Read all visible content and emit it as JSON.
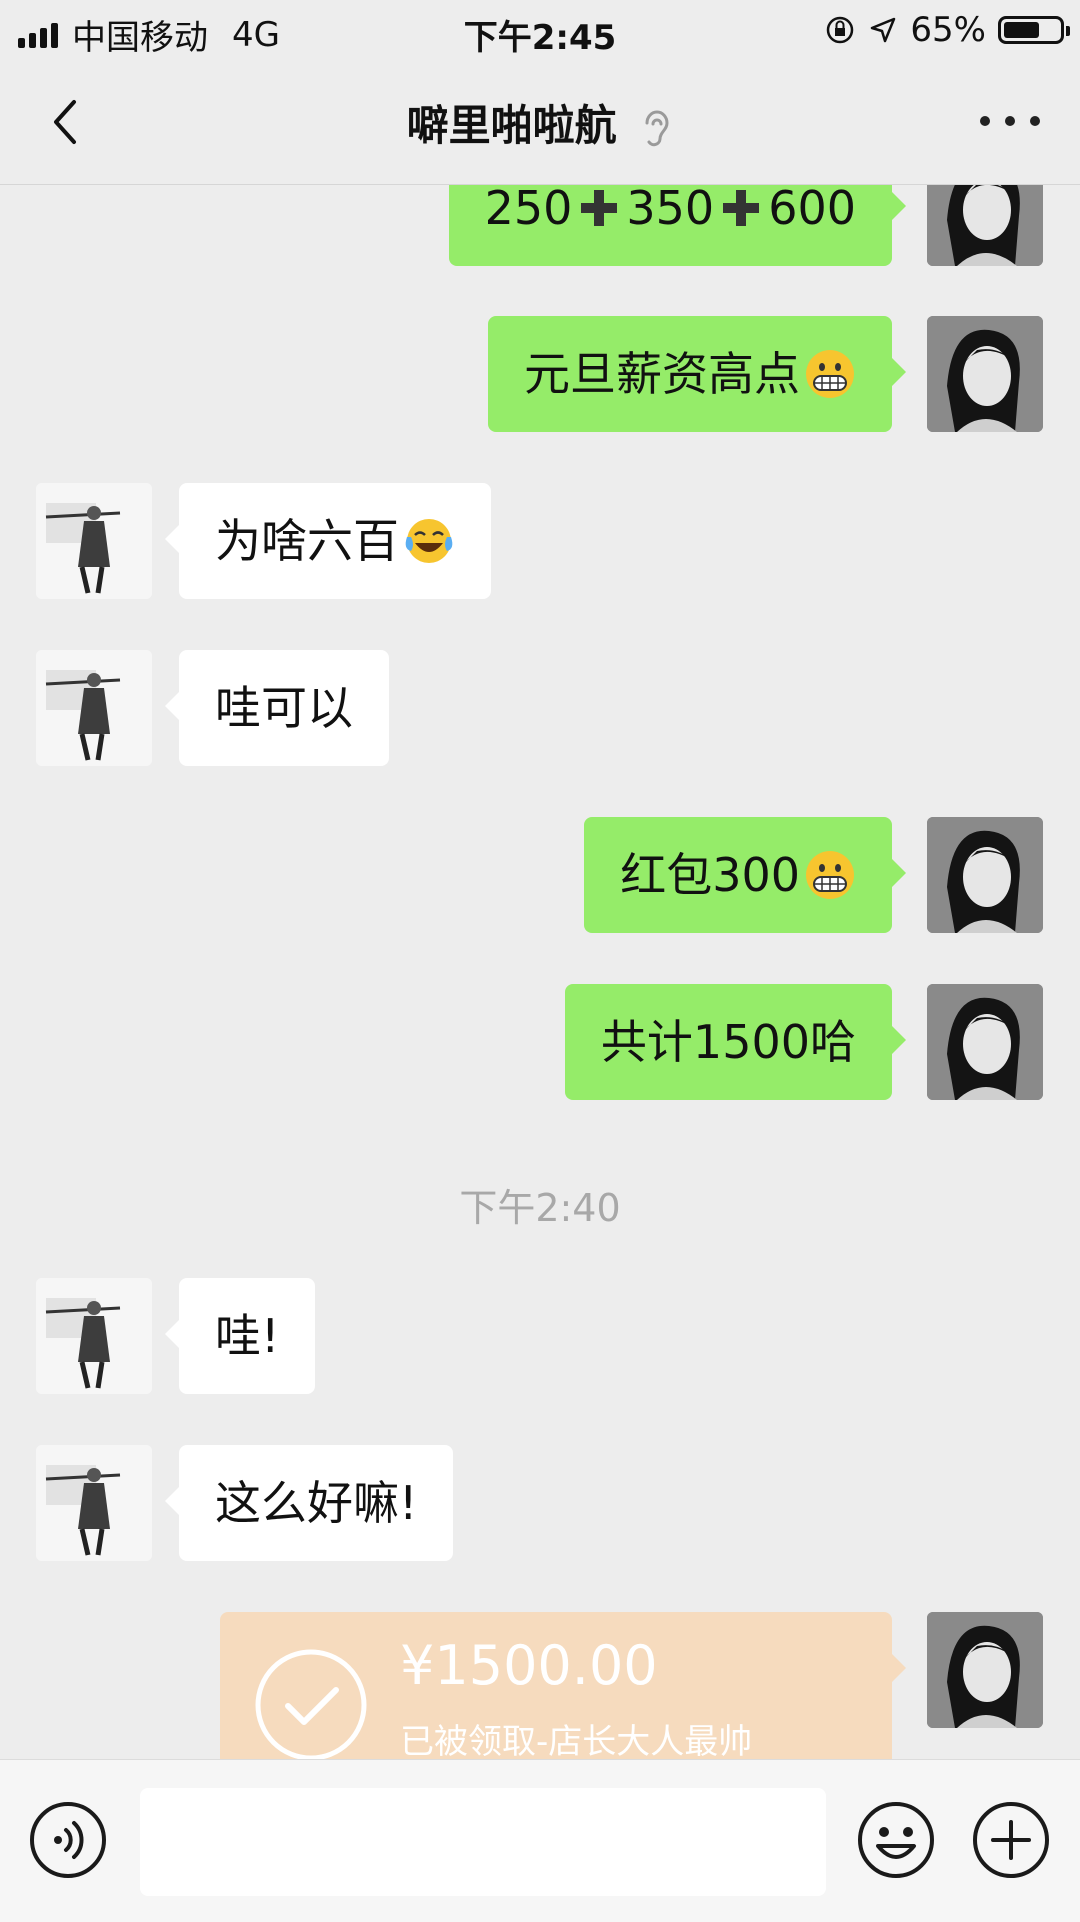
{
  "status_bar": {
    "carrier": "中国移动",
    "network": "4G",
    "time": "下午2:45",
    "battery_percent": "65%",
    "battery_level": 0.65
  },
  "nav": {
    "title": "噼里啪啦航",
    "icons": [
      "back-arrow-icon",
      "ear-icon",
      "more-dots-icon"
    ]
  },
  "messages": [
    {
      "sender": "me",
      "text": "250",
      "text2": "350",
      "text3": "600",
      "icon": "heavy-plus-emoji"
    },
    {
      "sender": "me",
      "text": "元旦薪资高点",
      "icon": "grimacing-face-emoji"
    },
    {
      "sender": "them",
      "text": "为啥六百",
      "icon": "tears-of-joy-emoji"
    },
    {
      "sender": "them",
      "text": "哇可以"
    },
    {
      "sender": "me",
      "text": "红包300",
      "icon": "grimacing-face-emoji"
    },
    {
      "sender": "me",
      "text": "共计1500哈"
    },
    {
      "sender": "them",
      "text": "哇!"
    },
    {
      "sender": "them",
      "text": "这么好嘛!"
    }
  ],
  "timestamp": "下午2:40",
  "transfer": {
    "amount": "¥1500.00",
    "status": "已被领取-店长大人最帅",
    "icon": "check-circle-icon"
  },
  "input_bar": {
    "icons": [
      "voice-icon",
      "emoji-icon",
      "add-icon"
    ],
    "draft": ""
  },
  "colors": {
    "background": "#ededed",
    "my_bubble": "#95ec69",
    "their_bubble": "#ffffff",
    "transfer_card": "#f6dbbe"
  }
}
